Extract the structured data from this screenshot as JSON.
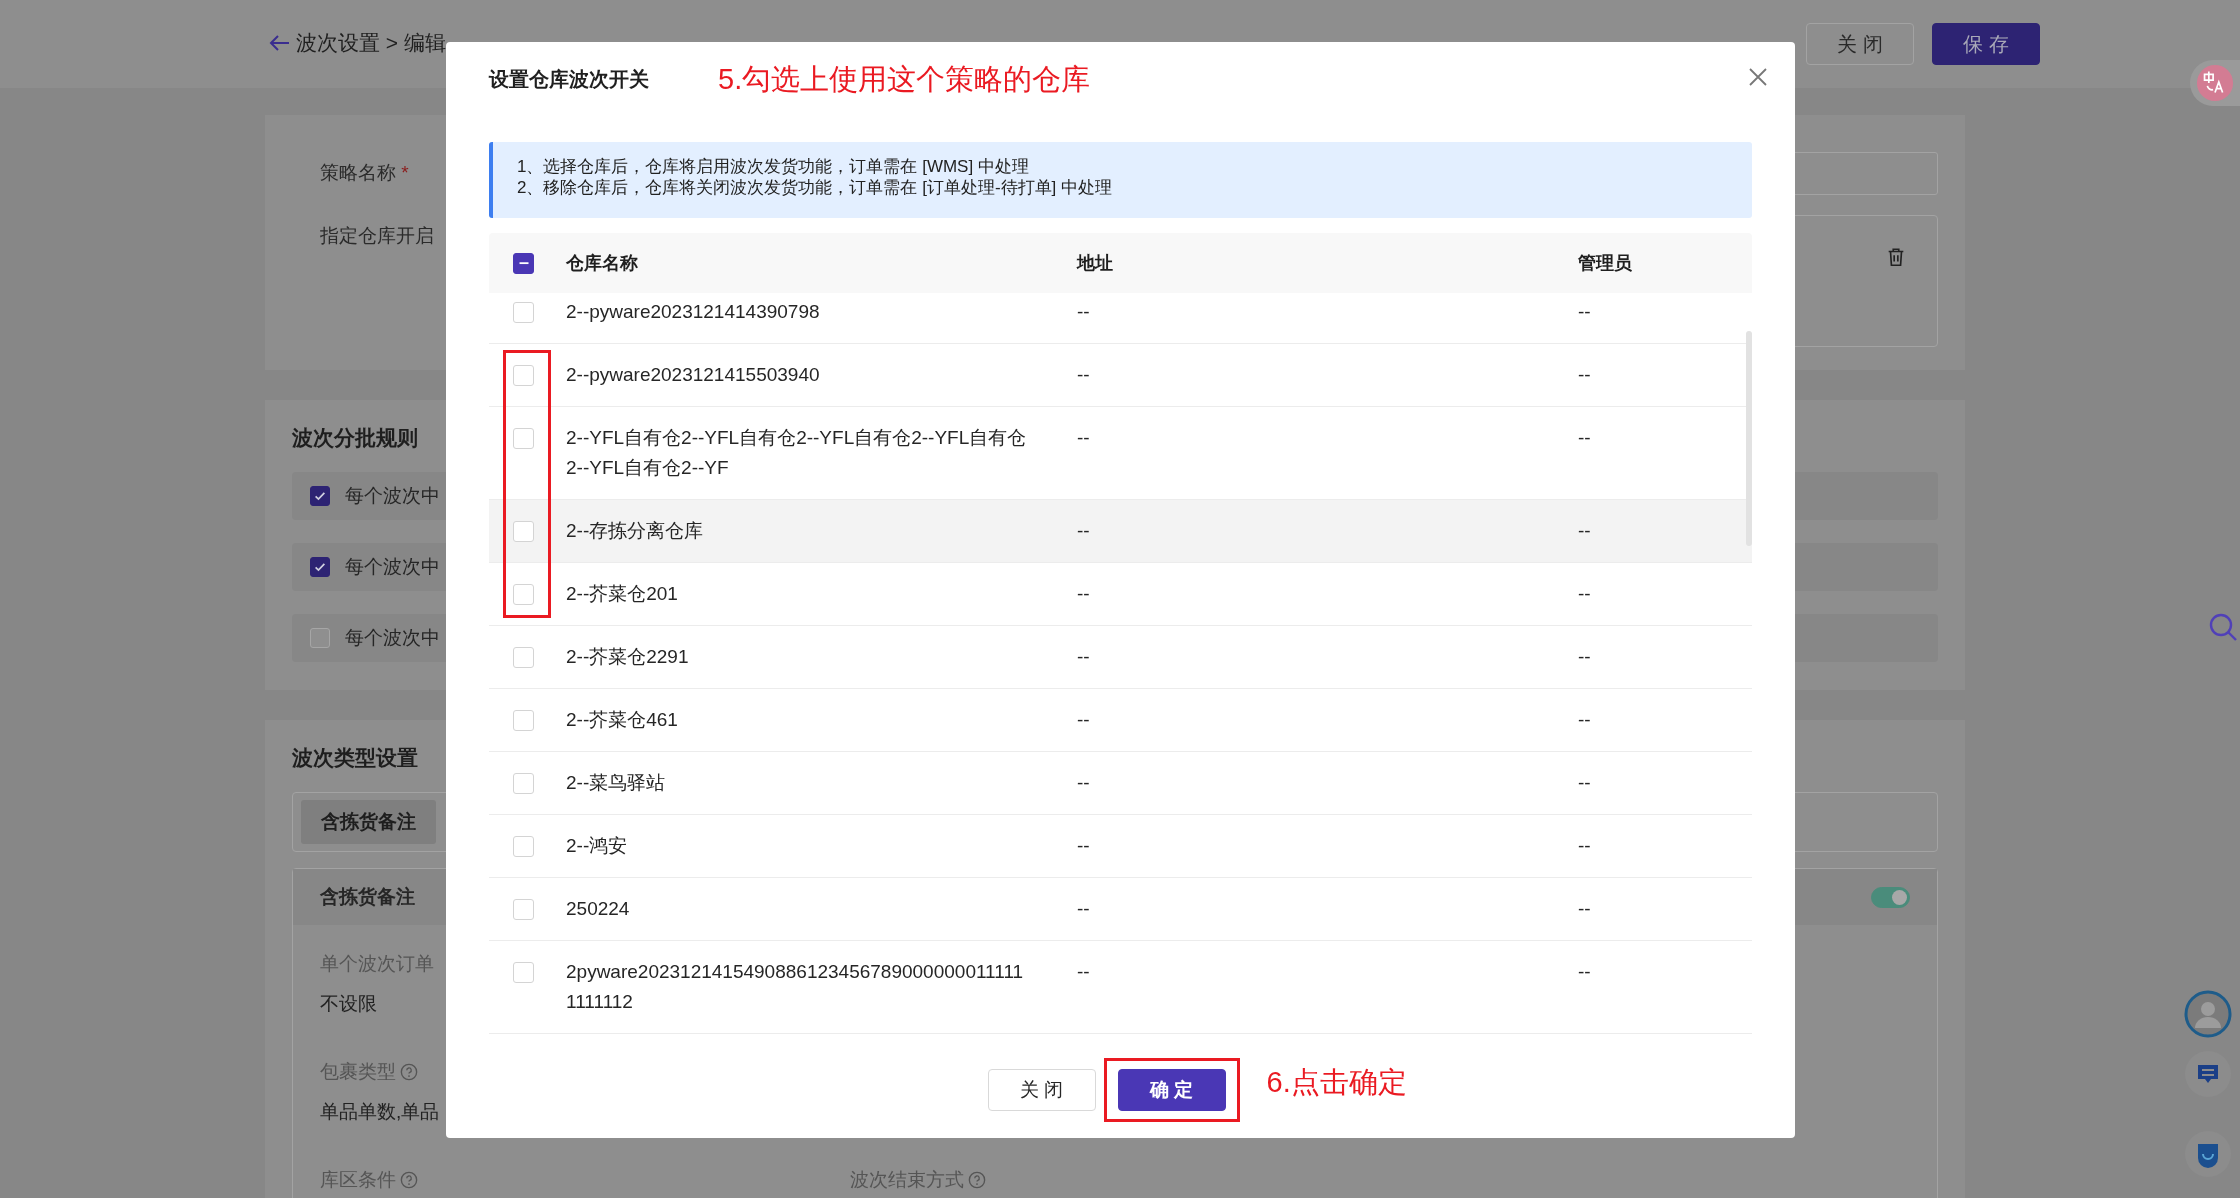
{
  "breadcrumb": "波次设置 > 编辑",
  "header_buttons": [
    {
      "label": "关 闭",
      "kind": "default"
    },
    {
      "label": "保 存",
      "kind": "primary"
    }
  ],
  "strategy_form": {
    "name_label": "策略名称",
    "required_mark": "*",
    "warehouse_label": "指定仓库开启"
  },
  "batch_rules": {
    "title": "波次分批规则",
    "rules": [
      {
        "label": "每个波次中",
        "checked": true
      },
      {
        "label": "每个波次中",
        "checked": true
      },
      {
        "label": "每个波次中",
        "checked": false
      }
    ]
  },
  "wave_types": {
    "title": "波次类型设置",
    "tabs": [
      {
        "label": "含拣货备注",
        "selected": true
      }
    ],
    "card": {
      "title": "含拣货备注",
      "enabled": true,
      "field_rows": [
        [
          {
            "label": "单个波次订单",
            "help": false,
            "value": "不设限"
          }
        ],
        [
          {
            "label": "包裹类型",
            "help": true,
            "value": "单品单数,单品"
          }
        ],
        [
          {
            "label": "库区条件",
            "help": true
          },
          {
            "label": "波次结束方式",
            "help": true
          }
        ]
      ]
    }
  },
  "dialog": {
    "title": "设置仓库波次开关",
    "info_lines": [
      "1、选择仓库后，仓库将启用波次发货功能，订单需在 [WMS] 中处理",
      "2、移除仓库后，仓库将关闭波次发货功能，订单需在 [订单处理-待打单] 中处理"
    ],
    "select_all": {
      "partial": true
    },
    "columns": [
      "仓库名称",
      "地址",
      "管理员"
    ],
    "rows": [
      {
        "name": "2--pyware2023121414390798",
        "address": "--",
        "manager": "--",
        "checked": false,
        "hovered": false
      },
      {
        "name": "2--pyware2023121415503940",
        "address": "--",
        "manager": "--",
        "checked": false,
        "hovered": false
      },
      {
        "name": "2--YFL自有仓2--YFL自有仓2--YFL自有仓2--YFL自有仓2--YFL自有仓2--YF",
        "address": "--",
        "manager": "--",
        "checked": false,
        "hovered": false
      },
      {
        "name": "2--存拣分离仓库",
        "address": "--",
        "manager": "--",
        "checked": false,
        "hovered": true
      },
      {
        "name": "2--芥菜仓201",
        "address": "--",
        "manager": "--",
        "checked": false,
        "hovered": false
      },
      {
        "name": "2--芥菜仓2291",
        "address": "--",
        "manager": "--",
        "checked": false,
        "hovered": false
      },
      {
        "name": "2--芥菜仓461",
        "address": "--",
        "manager": "--",
        "checked": false,
        "hovered": false
      },
      {
        "name": "2--菜鸟驿站",
        "address": "--",
        "manager": "--",
        "checked": false,
        "hovered": false
      },
      {
        "name": "2--鸿安",
        "address": "--",
        "manager": "--",
        "checked": false,
        "hovered": false
      },
      {
        "name": "250224",
        "address": "--",
        "manager": "--",
        "checked": false,
        "hovered": false
      },
      {
        "name": "2pyware20231214154908861234567890000000111111111112",
        "address": "--",
        "manager": "--",
        "checked": false,
        "hovered": false
      }
    ],
    "buttons": [
      {
        "label": "关 闭",
        "kind": "default"
      },
      {
        "label": "确 定",
        "kind": "primary"
      }
    ]
  },
  "annotations": [
    {
      "text": "5.勾选上使用这个策略的仓库"
    },
    {
      "text": "6.点击确定"
    }
  ]
}
